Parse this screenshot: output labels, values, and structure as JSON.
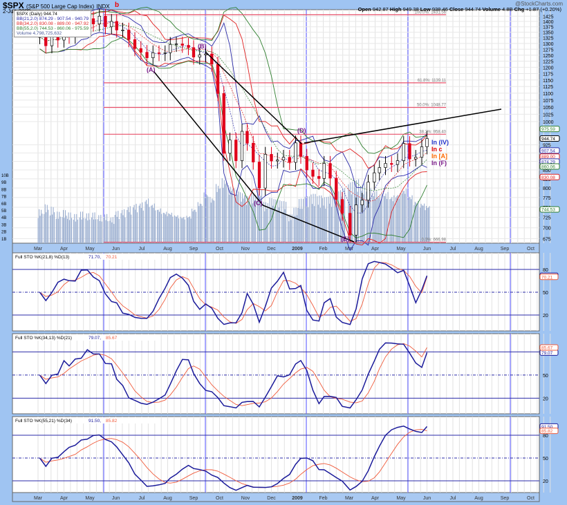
{
  "header": {
    "symbol": "$SPX",
    "name": "(S&P 500 Large Cap Index)",
    "exchange": "INDX",
    "date": "2-Jun-2009",
    "mark": "b",
    "brand": "@StockCharts.com",
    "open_label": "Open",
    "open": "942.87",
    "high_label": "High",
    "high": "949.38",
    "low_label": "Low",
    "low": "938.46",
    "close_label": "Close",
    "close": "944.74",
    "volume_label": "Volume",
    "volume": "4.8B",
    "chg_label": "Chg",
    "chg": "+1.87 (+0.20%)"
  },
  "legend": [
    "$SPX (Daily) 944.74",
    "BB(21,2.0) 874.29 - 907.54 - 940.79",
    "BB(34,2.0) 830.08 - 889.00 - 947.92",
    "BB(55,2.0) 744.53 - 860.06 - 975.59",
    "Volume 4,798,725,632"
  ],
  "colors": {
    "frame": "#9fc4f2",
    "up": "#000000",
    "down": "#e0001b",
    "bb21": "#2a2aa8",
    "bb34": "#e02020",
    "bb55": "#2f7f2f",
    "fib": "#e8506a",
    "k": "#1a1a9a",
    "d": "#f05a3a",
    "volume": "#9aaed0"
  },
  "annotations": {
    "waves": [
      "(A)",
      "(B)",
      "(C)",
      "(D)",
      "(E)"
    ],
    "labels": [
      {
        "text": "In (IV)",
        "color": "#2233cc"
      },
      {
        "text": "In c",
        "color": "#e00000"
      },
      {
        "text": "In [A]",
        "color": "#ff6a00"
      },
      {
        "text": "In (F)",
        "color": "#7a1a8a"
      }
    ]
  },
  "chart_data": {
    "type": "candlestick",
    "title": "$SPX (S&P 500 Large Cap Index) Daily",
    "start": "2008-03-03",
    "interval_days": 7,
    "closes": [
      1330,
      1290,
      1330,
      1315,
      1370,
      1332,
      1390,
      1397,
      1413,
      1388,
      1425,
      1375,
      1400,
      1360,
      1360,
      1317,
      1278,
      1262,
      1239,
      1260,
      1257,
      1260,
      1296,
      1298,
      1292,
      1282,
      1242,
      1251,
      1255,
      1213,
      1099,
      899,
      940,
      877,
      968,
      930,
      873,
      800,
      896,
      876,
      879,
      887,
      872,
      931,
      890,
      850,
      832,
      826,
      869,
      827,
      770,
      735,
      683,
      756,
      768,
      816,
      842,
      857,
      869,
      866,
      877,
      929,
      882,
      887,
      919,
      944.74
    ],
    "volume_billions": [
      4.2,
      4.8,
      4.5,
      3.9,
      4.1,
      3.8,
      3.6,
      3.9,
      3.7,
      3.8,
      3.5,
      3.6,
      3.2,
      4.0,
      4.2,
      4.6,
      4.9,
      5.1,
      5.6,
      5.0,
      4.4,
      4.0,
      3.9,
      3.6,
      3.4,
      3.5,
      4.4,
      5.2,
      6.4,
      5.8,
      7.4,
      8.1,
      7.2,
      6.8,
      6.3,
      5.9,
      6.2,
      6.9,
      5.1,
      5.6,
      5.4,
      5.2,
      3.6,
      4.4,
      5.5,
      5.8,
      6.1,
      5.9,
      5.7,
      5.9,
      6.4,
      6.8,
      7.6,
      7.9,
      7.4,
      6.8,
      6.5,
      6.2,
      6.4,
      6.0,
      6.3,
      6.9,
      6.1,
      5.4,
      5.1,
      4.8
    ],
    "price_ticks": [
      1425,
      1400,
      1375,
      1350,
      1325,
      1300,
      1275,
      1250,
      1225,
      1200,
      1175,
      1150,
      1125,
      1100,
      1075,
      1050,
      1025,
      1000,
      925,
      900,
      875,
      850,
      825,
      800,
      775,
      750,
      725,
      700,
      675
    ],
    "price_scale": "log",
    "ylim": [
      660,
      1440
    ],
    "volume_ticks": [
      "10B",
      "9B",
      "8B",
      "7B",
      "6B",
      "5B",
      "4B",
      "3B",
      "2B",
      "1B"
    ],
    "months": [
      "Mar",
      "Apr",
      "May",
      "Jun",
      "Jul",
      "Aug",
      "Sep",
      "Oct",
      "Nov",
      "Dec",
      "2009",
      "Feb",
      "Mar",
      "Apr",
      "May",
      "Jun",
      "Jul",
      "Aug",
      "Sep",
      "Oct"
    ],
    "fib_levels": [
      {
        "label": "100.0%: 1431.56",
        "value": 1431.56
      },
      {
        "label": "61.8%: 1139.11",
        "value": 1139.11
      },
      {
        "label": "50.0%: 1048.77",
        "value": 1048.77
      },
      {
        "label": "38.2%: 958.40",
        "value": 958.4
      },
      {
        "label": "0.0%: 666.98",
        "value": 666.98
      }
    ],
    "right_markers": [
      {
        "text": "975.59",
        "color": "#2f7f2f",
        "value": 975.59
      },
      {
        "text": "944.74",
        "color": "#000000",
        "value": 944.74
      },
      {
        "text": "907.54",
        "color": "#2a2aa8",
        "value": 907.54
      },
      {
        "text": "889.00",
        "color": "#e02020",
        "value": 889
      },
      {
        "text": "874.29",
        "color": "#2a2aa8",
        "value": 874.29
      },
      {
        "text": "860.06",
        "color": "#2f7f2f",
        "value": 860.06
      },
      {
        "text": "830.08",
        "color": "#e02020",
        "value": 830.08
      },
      {
        "text": "744.53",
        "color": "#2f7f2f",
        "value": 744.53
      }
    ],
    "stochastics": [
      {
        "title": "Full STO %K(21,8) %D(13)",
        "k": "71.70",
        "d": "70.21",
        "k_value": 71.7,
        "d_value": 70.21,
        "lookback": 4,
        "smooth": 2,
        "dper": 3,
        "ticks": [
          "80",
          "50",
          "20"
        ]
      },
      {
        "title": "Full STO %K(34,13) %D(21)",
        "k": "79.07",
        "d": "85.67",
        "k_value": 79.07,
        "d_value": 85.67,
        "lookback": 7,
        "smooth": 3,
        "dper": 4,
        "ticks": [
          "80",
          "50",
          "20"
        ]
      },
      {
        "title": "Full STO %K(55,21) %D(34)",
        "k": "91.50",
        "d": "85.82",
        "k_value": 91.5,
        "d_value": 85.82,
        "lookback": 11,
        "smooth": 4,
        "dper": 6,
        "ticks": [
          "80",
          "50",
          "20"
        ]
      }
    ]
  }
}
